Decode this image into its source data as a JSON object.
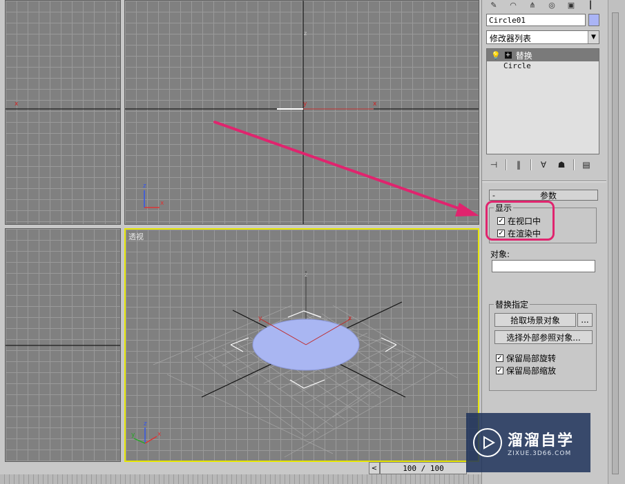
{
  "viewports": {
    "perspective_label": "透视",
    "axis_x": "x",
    "axis_y": "y",
    "axis_z": "z"
  },
  "panel": {
    "object_name": "Circle01",
    "object_color": "#aab4f5",
    "modifier_list": "修改器列表",
    "stack": {
      "selected": "替换",
      "base": "Circle"
    },
    "rollout": {
      "collapse": "-",
      "title": "参数",
      "display_group": "显示",
      "in_viewport": "在视口中",
      "in_viewport_checked": true,
      "in_render": "在渲染中",
      "in_render_checked": true,
      "object_label": "对象:",
      "replace_group": "替换指定",
      "pick_scene_object": "拾取场景对象",
      "ellipsis": "...",
      "select_xref": "选择外部参照对象...",
      "keep_local_rotation": "保留局部旋转",
      "keep_local_rotation_checked": true,
      "keep_local_scale": "保留局部缩放",
      "keep_local_scale_checked": true
    }
  },
  "timeline": {
    "frame": "100 / 100",
    "prev": "<"
  },
  "watermark": {
    "main": "溜溜自学",
    "sub": "ZIXUE.3D66.COM"
  },
  "accent": "#e0246e"
}
